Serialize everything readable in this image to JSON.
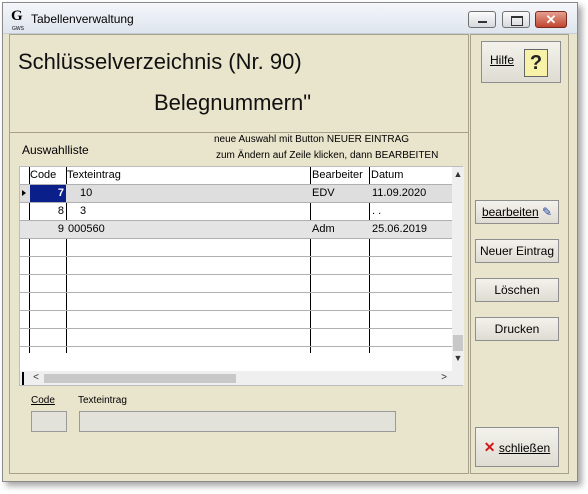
{
  "window": {
    "title": "Tabellenverwaltung",
    "logo_letter": "G",
    "logo_sub": "GWS"
  },
  "header": {
    "line1": "Schlüsselverzeichnis (Nr. 90)",
    "line2": "Belegnummern\""
  },
  "list": {
    "label": "Auswahlliste",
    "hint1": "neue Auswahl mit Button NEUER EINTRAG",
    "hint2": "zum Ändern auf Zeile klicken, dann BEARBEITEN",
    "columns": [
      "Code",
      "Texteintrag",
      "Bearbeiter",
      "Datum"
    ],
    "rows": [
      {
        "code": "7",
        "text": "10",
        "bearbeiter": "EDV",
        "datum": "11.09.2020"
      },
      {
        "code": "8",
        "text": "3",
        "bearbeiter": "",
        "datum": ". ."
      },
      {
        "code": "9",
        "text": "000560",
        "bearbeiter": "Adm",
        "datum": "25.06.2019"
      }
    ]
  },
  "detail": {
    "code_label": "Code",
    "text_label": "Texteintrag",
    "code_value": "",
    "text_value": ""
  },
  "buttons": {
    "hilfe": "Hilfe",
    "bearbeiten": "bearbeiten",
    "neuer_eintrag": "Neuer Eintrag",
    "loeschen": "Löschen",
    "drucken": "Drucken",
    "schliessen": "schließen"
  },
  "icons": {
    "hilfe": "question-icon",
    "bearbeiten": "edit-icon",
    "schliessen": "close-icon"
  }
}
